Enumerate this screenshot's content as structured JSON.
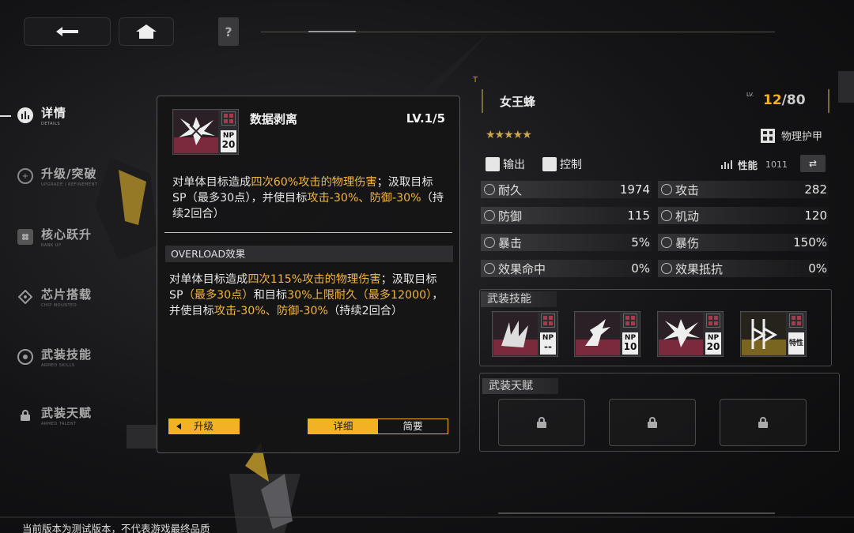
{
  "topbar": {
    "back_icon": "back-arrow-icon",
    "home_icon": "home-icon",
    "help_label": "?"
  },
  "nav": {
    "items": [
      {
        "label": "详情",
        "sublabel": "DETAILS",
        "icon": "details-icon",
        "active": true
      },
      {
        "label": "升级/突破",
        "sublabel": "UPGRADE / REFINEMENT",
        "icon": "upgrade-icon",
        "active": false
      },
      {
        "label": "核心跃升",
        "sublabel": "RANK UP",
        "icon": "core-icon",
        "active": false
      },
      {
        "label": "芯片搭载",
        "sublabel": "CHIP MOUNTED",
        "icon": "chip-icon",
        "active": false
      },
      {
        "label": "武装技能",
        "sublabel": "ARMED SKILLS",
        "icon": "skill-icon",
        "active": false
      },
      {
        "label": "武装天赋",
        "sublabel": "ARMED TALENT",
        "icon": "lock-icon",
        "active": false
      }
    ]
  },
  "popup": {
    "skill_name": "数据剥离",
    "level": "LV.1/5",
    "np_label": "NP",
    "np_value": "20",
    "desc_parts": [
      {
        "t": "对单体目标造成",
        "h": false
      },
      {
        "t": "四次60%攻击的物理伤害",
        "h": true
      },
      {
        "t": "；汲取目标SP（最多30点），并使目标",
        "h": false
      },
      {
        "t": "攻击-30%、防御-30%",
        "h": true
      },
      {
        "t": "（持续2回合）",
        "h": false
      }
    ],
    "overload_label": "OVERLOAD效果",
    "overload_parts": [
      {
        "t": "对单体目标造成",
        "h": false
      },
      {
        "t": "四次115%攻击的物理伤害",
        "h": true
      },
      {
        "t": "；汲取目标SP",
        "h": false
      },
      {
        "t": "（最多30点）",
        "h": true
      },
      {
        "t": "和目标",
        "h": false
      },
      {
        "t": "30%上限耐久（最多12000）",
        "h": true
      },
      {
        "t": "，并使目标",
        "h": false
      },
      {
        "t": "攻击-30%、防御-30%",
        "h": true
      },
      {
        "t": "（持续2回合）",
        "h": false
      }
    ],
    "upgrade_button": "升级",
    "tab_detail": "详细",
    "tab_brief": "简要"
  },
  "character": {
    "name": "女王蜂",
    "lv_label": "LV.",
    "level": "12",
    "level_max": "80",
    "stars": "★★★★★",
    "armor_type": "物理护甲",
    "tags": [
      "输出",
      "控制"
    ],
    "performance_label": "性能",
    "performance_value": "1011",
    "stats": [
      {
        "label": "耐久",
        "value": "1974",
        "icon": "durability-icon"
      },
      {
        "label": "攻击",
        "value": "282",
        "icon": "attack-icon"
      },
      {
        "label": "防御",
        "value": "115",
        "icon": "defense-icon"
      },
      {
        "label": "机动",
        "value": "120",
        "icon": "mobility-icon"
      },
      {
        "label": "暴击",
        "value": "5%",
        "icon": "crit-icon"
      },
      {
        "label": "暴伤",
        "value": "150%",
        "icon": "crit-damage-icon"
      },
      {
        "label": "效果命中",
        "value": "0%",
        "icon": "effect-hit-icon"
      },
      {
        "label": "效果抵抗",
        "value": "0%",
        "icon": "effect-resist-icon"
      }
    ]
  },
  "armed_skills": {
    "title": "武装技能",
    "skills": [
      {
        "np_label": "NP",
        "np_value": "--",
        "icon": "claw-skill-icon"
      },
      {
        "np_label": "NP",
        "np_value": "10",
        "icon": "dash-skill-icon"
      },
      {
        "np_label": "NP",
        "np_value": "20",
        "icon": "data-strip-skill-icon"
      },
      {
        "np_label": "",
        "np_value": "特性",
        "icon": "trait-skill-icon"
      }
    ]
  },
  "armed_talent": {
    "title": "武装天赋"
  },
  "footer": "当前版本为测试版本，不代表游戏最终品质",
  "colors": {
    "accent": "#f2b224",
    "highlight_text": "#f2b640"
  }
}
